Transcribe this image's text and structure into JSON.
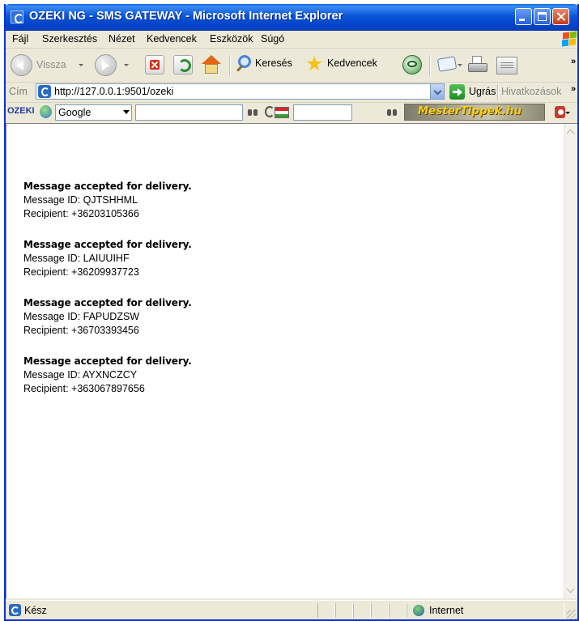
{
  "window": {
    "title": "OZEKI NG - SMS GATEWAY - Microsoft Internet Explorer"
  },
  "menubar": {
    "items": [
      "Fájl",
      "Szerkesztés",
      "Nézet",
      "Kedvencek",
      "Eszközök",
      "Súgó"
    ]
  },
  "toolbar": {
    "back_label": "Vissza",
    "search_label": "Keresés",
    "favorites_label": "Kedvencek",
    "overflow_label": "»"
  },
  "addressbar": {
    "label": "Cím",
    "url": "http://127.0.0.1:9501/ozeki",
    "go_label": "Ugrás",
    "links_label": "Hivatkozások",
    "overflow_label": "»"
  },
  "googlebar": {
    "brand": "OZEKI",
    "engine": "Google",
    "banner": "MesterTippek.hu"
  },
  "content": {
    "messages": [
      {
        "status": "Message accepted for delivery.",
        "id_line": "Message ID: QJTSHHML",
        "recipient_line": "Recipient: +36203105366"
      },
      {
        "status": "Message accepted for delivery.",
        "id_line": "Message ID: LAIUUIHF",
        "recipient_line": "Recipient: +36209937723"
      },
      {
        "status": "Message accepted for delivery.",
        "id_line": "Message ID: FAPUDZSW",
        "recipient_line": "Recipient: +36703393456"
      },
      {
        "status": "Message accepted for delivery.",
        "id_line": "Message ID: AYXNCZCY",
        "recipient_line": "Recipient: +363067897656"
      }
    ]
  },
  "statusbar": {
    "status": "Kész",
    "zone": "Internet"
  },
  "colors": {
    "title_bar": "#0a55d8",
    "chrome": "#ece9d8",
    "close_button": "#c23a16",
    "banner_text": "#f5d020"
  }
}
